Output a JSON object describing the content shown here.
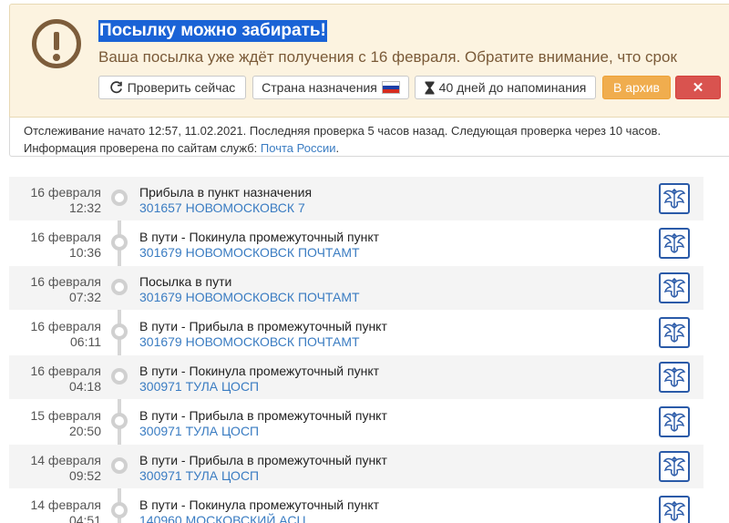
{
  "alert": {
    "icon": "exclamation-circle-icon",
    "title": "Посылку можно забирать!",
    "text": "Ваша посылка уже ждёт получения с 16 февраля. Обратите внимание, что срок",
    "buttons": {
      "check": "Проверить сейчас",
      "country": "Страна назначения",
      "days": "40 дней до напоминания",
      "archive": "В архив",
      "close": "✕"
    }
  },
  "info": {
    "line1": "Отслеживание начато 12:57, 11.02.2021. Последняя проверка 5 часов назад. Следующая проверка через 10 часов.",
    "line2_prefix": "Информация проверена по сайтам служб:",
    "service_link": "Почта России",
    "line2_suffix": "."
  },
  "events": [
    {
      "date": "16 февраля",
      "time": "12:32",
      "status": "Прибыла в пункт назначения",
      "place": "301657 НОВОМОСКОВСК 7"
    },
    {
      "date": "16 февраля",
      "time": "10:36",
      "status": "В пути - Покинула промежуточный пункт",
      "place": "301679 НОВОМОСКОВСК ПОЧТАМТ"
    },
    {
      "date": "16 февраля",
      "time": "07:32",
      "status": "Посылка в пути",
      "place": "301679 НОВОМОСКОВСК ПОЧТАМТ"
    },
    {
      "date": "16 февраля",
      "time": "06:11",
      "status": "В пути - Прибыла в промежуточный пункт",
      "place": "301679 НОВОМОСКОВСК ПОЧТАМТ"
    },
    {
      "date": "16 февраля",
      "time": "04:18",
      "status": "В пути - Покинула промежуточный пункт",
      "place": "300971 ТУЛА ЦОСП"
    },
    {
      "date": "15 февраля",
      "time": "20:50",
      "status": "В пути - Прибыла в промежуточный пункт",
      "place": "300971 ТУЛА ЦОСП"
    },
    {
      "date": "14 февраля",
      "time": "09:52",
      "status": "В пути - Прибыла в промежуточный пункт",
      "place": "300971 ТУЛА ЦОСП"
    },
    {
      "date": "14 февраля",
      "time": "04:51",
      "status": "В пути - Покинула промежуточный пункт",
      "place": "140960 МОСКОВСКИЙ АСЦ"
    }
  ],
  "colors": {
    "alert_bg": "#fcf3e0",
    "alert_text": "#7a5a38",
    "title_highlight": "#1a63d6",
    "link": "#3a7cc2",
    "archive": "#f0ad4e",
    "close": "#d9534f",
    "logo": "#2a5aa8"
  }
}
